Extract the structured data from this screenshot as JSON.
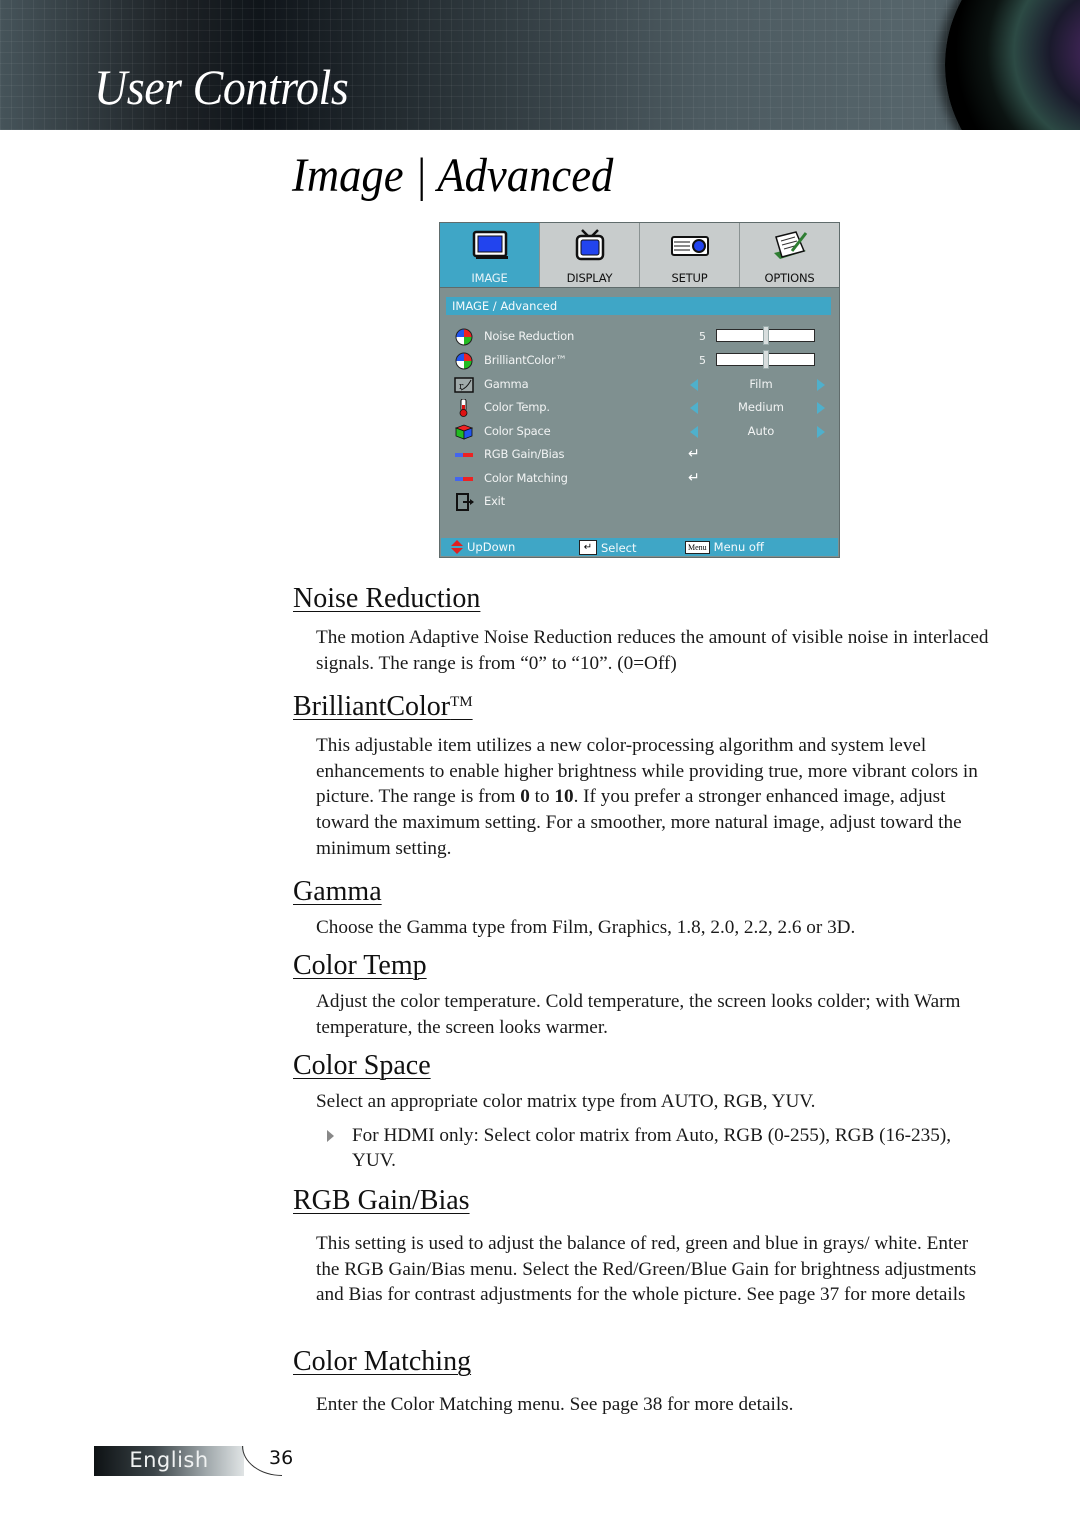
{
  "header": {
    "section_title": "User Controls",
    "page_title": "Image | Advanced"
  },
  "osd": {
    "tabs": [
      {
        "label": "IMAGE",
        "icon": "monitor-icon",
        "active": true
      },
      {
        "label": "DISPLAY",
        "icon": "tv-icon",
        "active": false
      },
      {
        "label": "SETUP",
        "icon": "projector-icon",
        "active": false
      },
      {
        "label": "OPTIONS",
        "icon": "notepad-icon",
        "active": false
      }
    ],
    "breadcrumb": "IMAGE / Advanced",
    "items": [
      {
        "label": "Noise Reduction",
        "icon": "color-wheel-icon",
        "type": "slider",
        "value": "5",
        "level": 0.5
      },
      {
        "label": "BrilliantColor™",
        "icon": "color-wheel-icon",
        "type": "slider",
        "value": "5",
        "level": 0.5
      },
      {
        "label": "Gamma",
        "icon": "gamma-icon",
        "type": "select",
        "value": "Film"
      },
      {
        "label": "Color Temp.",
        "icon": "thermometer-icon",
        "type": "select",
        "value": "Medium"
      },
      {
        "label": "Color Space",
        "icon": "color-cube-icon",
        "type": "select",
        "value": "Auto"
      },
      {
        "label": "RGB Gain/Bias",
        "icon": "rgb-bar-icon",
        "type": "submenu",
        "value": "↵"
      },
      {
        "label": "Color Matching",
        "icon": "rgb-bar-icon",
        "type": "submenu",
        "value": "↵"
      },
      {
        "label": "Exit",
        "icon": "exit-icon",
        "type": "action"
      }
    ],
    "footer": {
      "updown": "UpDown",
      "select": "Select",
      "menu_key": "Menu",
      "menu_off": "Menu off"
    },
    "colors": {
      "accent": "#3fa6c6",
      "panel": "#7f9090",
      "tab": "#c8cccc"
    }
  },
  "sections": [
    {
      "title": "Noise Reduction",
      "body": [
        "The motion Adaptive Noise Reduction reduces the amount of visible noise in interlaced signals. The range is from “0” to “10”. (0=Off)"
      ]
    },
    {
      "title": "BrilliantColor",
      "title_sup": "TM",
      "body_parts": [
        "This adjustable item utilizes a new color-processing algorithm and system level enhancements to enable higher brightness while providing true, more vibrant colors in picture. The range is from ",
        "0",
        " to ",
        "10",
        ". If you prefer a stronger enhanced image, adjust toward the maximum setting. For a smoother, more natural image, adjust toward the minimum setting."
      ]
    },
    {
      "title": "Gamma",
      "body": [
        "Choose the Gamma type from Film, Graphics, 1.8, 2.0, 2.2, 2.6 or 3D."
      ]
    },
    {
      "title": "Color Temp",
      "body": [
        "Adjust the color temperature. Cold temperature, the screen looks colder; with Warm temperature, the screen looks warmer."
      ]
    },
    {
      "title": "Color Space",
      "body": [
        "Select an appropriate color matrix type from AUTO, RGB, YUV."
      ],
      "bullet": "For HDMI only: Select color matrix from Auto, RGB (0-255), RGB (16-235), YUV."
    },
    {
      "title": "RGB Gain/Bias",
      "body": [
        "This setting is used to adjust the balance of red, green and blue in grays/ white. Enter the RGB Gain/Bias menu. Select the Red/Green/Blue Gain for brightness adjustments and Bias for contrast adjustments for the whole picture. See page 37 for more details"
      ]
    },
    {
      "title": "Color Matching",
      "body": [
        "Enter the Color Matching menu. See page 38 for more details."
      ]
    }
  ],
  "footer": {
    "language": "English",
    "page_number": "36"
  }
}
